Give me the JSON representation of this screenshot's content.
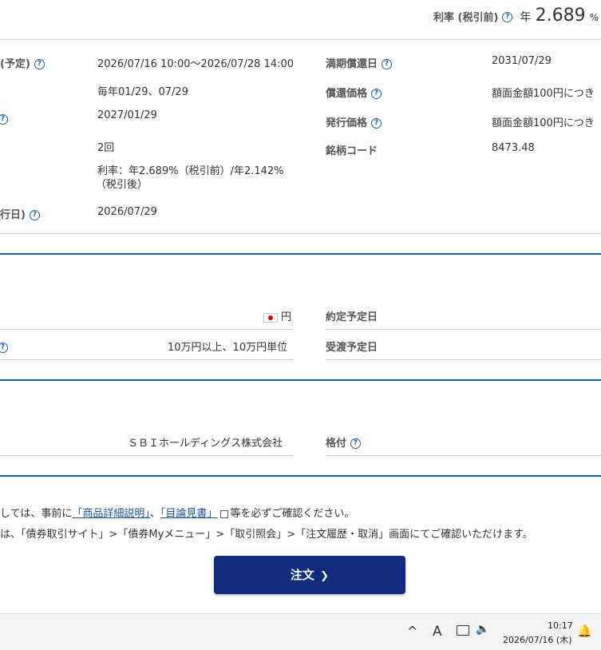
{
  "header": {
    "rate_label": "利率 (税引前)",
    "rate_prefix": "年",
    "rate_value": "2.689",
    "rate_unit": "%"
  },
  "details_left": [
    {
      "label": "(予定)",
      "value": "2026/07/16 10:00〜2026/07/28 14:00"
    },
    {
      "label": "",
      "value": "毎年01/29、07/29"
    },
    {
      "label": "",
      "value": "2027/01/29"
    },
    {
      "label": "",
      "value": "2回"
    },
    {
      "label": "",
      "value": "利率：年2.689%（税引前）/年2.142%",
      "value2": "（税引後）"
    },
    {
      "label": "行日)",
      "value": "2026/07/29"
    }
  ],
  "details_right": [
    {
      "label": "満期償還日",
      "value": "2031/07/29"
    },
    {
      "label": "償還価格",
      "value": "額面金額100円につき"
    },
    {
      "label": "発行価格",
      "value": "額面金額100円につき"
    },
    {
      "label": "銘柄コード",
      "value": "8473.48"
    }
  ],
  "trade": {
    "currency": "円",
    "min_unit": "10万円以上、10万円単位",
    "contract_date_label": "約定予定日",
    "settlement_date_label": "受渡予定日"
  },
  "issuer": {
    "name": "ＳＢＩホールディングス株式会社",
    "rating_label": "格付"
  },
  "notes": {
    "line1_prefix": "しては、事前に",
    "link1": "「商品詳細説明」",
    "sep": "、",
    "link2": "「目論見書」",
    "line1_suffix": "等を必ずご確認ください。",
    "line2": "は、「債券取引サイト」>「債券Myメニュー」>「取引照会」>「注文履歴・取消」画面にてご確認いただけます。"
  },
  "order_button": {
    "label": "注文",
    "chevron": "❯"
  },
  "taskbar": {
    "time": "10:17",
    "date": "2026/07/16 (木)",
    "ime": "A",
    "chevron": "^"
  }
}
